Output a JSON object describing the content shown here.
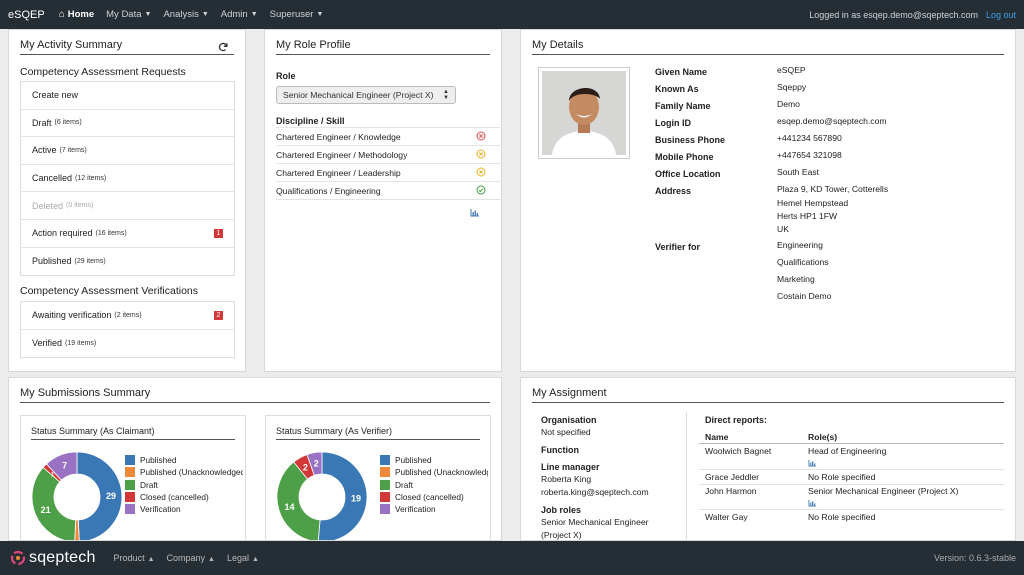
{
  "nav": {
    "brand": "eSQEP",
    "home": "Home",
    "items": [
      "My Data",
      "Analysis",
      "Admin",
      "Superuser"
    ],
    "logged_in": "Logged in as esqep.demo@sqeptech.com",
    "logout": "Log out"
  },
  "activity": {
    "title": "My Activity Summary",
    "requests_heading": "Competency Assessment Requests",
    "requests": [
      {
        "label": "Create new",
        "count": ""
      },
      {
        "label": "Draft",
        "count": "(6 items)"
      },
      {
        "label": "Active",
        "count": "(7 items)"
      },
      {
        "label": "Cancelled",
        "count": "(12 items)"
      },
      {
        "label": "Deleted",
        "count": "(0 items)"
      },
      {
        "label": "Action required",
        "count": "(16 items)",
        "badge": "1"
      },
      {
        "label": "Published",
        "count": "(29 items)"
      }
    ],
    "verifications_heading": "Competency Assessment Verifications",
    "verifications": [
      {
        "label": "Awaiting verification",
        "count": "(2 items)",
        "badge": "2"
      },
      {
        "label": "Verified",
        "count": "(19 items)"
      }
    ]
  },
  "role": {
    "title": "My Role Profile",
    "role_label": "Role",
    "role_value": "Senior Mechanical Engineer (Project X)",
    "discipline_label": "Discipline / Skill",
    "skills": [
      {
        "name": "Chartered Engineer / Knowledge",
        "status": "fail",
        "color": "#d9534f"
      },
      {
        "name": "Chartered Engineer / Methodology",
        "status": "partial",
        "color": "#e6b422"
      },
      {
        "name": "Chartered Engineer / Leadership",
        "status": "partial",
        "color": "#e6b422"
      },
      {
        "name": "Qualifications / Engineering",
        "status": "ok",
        "color": "#3c9a3c"
      }
    ]
  },
  "details": {
    "title": "My Details",
    "given_name_label": "Given Name",
    "given_name": "eSQEP",
    "known_as_label": "Known As",
    "known_as": "Sqeppy",
    "family_name_label": "Family Name",
    "family_name": "Demo",
    "login_label": "Login ID",
    "login": "esqep.demo@sqeptech.com",
    "bphone_label": "Business Phone",
    "bphone": "+441234 567890",
    "mphone_label": "Mobile Phone",
    "mphone": "+447654 321098",
    "office_label": "Office Location",
    "office": "South East",
    "address_label": "Address",
    "address": [
      "Plaza 9, KD Tower, Cotterells",
      "Hemel Hempstead",
      "Herts HP1 1FW",
      "UK"
    ],
    "verifier_label": "Verifier for",
    "verifier": [
      "Engineering",
      "Qualifications",
      "Marketing",
      "Costain Demo"
    ]
  },
  "submissions": {
    "title": "My Submissions Summary",
    "legend": [
      "Published",
      "Published (Unacknowledged)",
      "Draft",
      "Closed (cancelled)",
      "Verification"
    ],
    "colors": [
      "#3a78b5",
      "#f0883a",
      "#4da048",
      "#d23838",
      "#9a72c4"
    ]
  },
  "chart_data": [
    {
      "type": "pie",
      "title": "Status Summary (As Claimant)",
      "categories": [
        "Published",
        "Published (Unacknowledged)",
        "Draft",
        "Closed (cancelled)",
        "Verification"
      ],
      "values": [
        29,
        1,
        21,
        1,
        7
      ],
      "labels": [
        "29",
        "",
        "21",
        "1",
        "7"
      ]
    },
    {
      "type": "pie",
      "title": "Status Summary (As Verifier)",
      "categories": [
        "Published",
        "Published (Unacknowledged)",
        "Draft",
        "Closed (cancelled)",
        "Verification"
      ],
      "values": [
        19,
        0,
        14,
        2,
        2
      ],
      "labels": [
        "19",
        "",
        "14",
        "2",
        "2"
      ]
    }
  ],
  "assignment": {
    "title": "My Assignment",
    "org_label": "Organisation",
    "org": "Not specified",
    "function_label": "Function",
    "manager_label": "Line manager",
    "manager_name": "Roberta King",
    "manager_email": "roberta.king@sqeptech.com",
    "jobroles_label": "Job roles",
    "jobroles": [
      "Senior Mechanical Engineer",
      "(Project X)"
    ],
    "reports_label": "Direct reports:",
    "col_name": "Name",
    "col_roles": "Role(s)",
    "reports": [
      {
        "name": "Woolwich Bagnet",
        "role": "Head of Engineering"
      },
      {
        "name": "Grace Jeddler",
        "role": "No Role specified"
      },
      {
        "name": "John Harmon",
        "role": "Senior Mechanical Engineer (Project X)"
      },
      {
        "name": "Walter Gay",
        "role": "No Role specified"
      }
    ]
  },
  "footer": {
    "logo": "sqeptech",
    "links": [
      "Product",
      "Company",
      "Legal"
    ],
    "version": "Version: 0.6.3-stable"
  }
}
